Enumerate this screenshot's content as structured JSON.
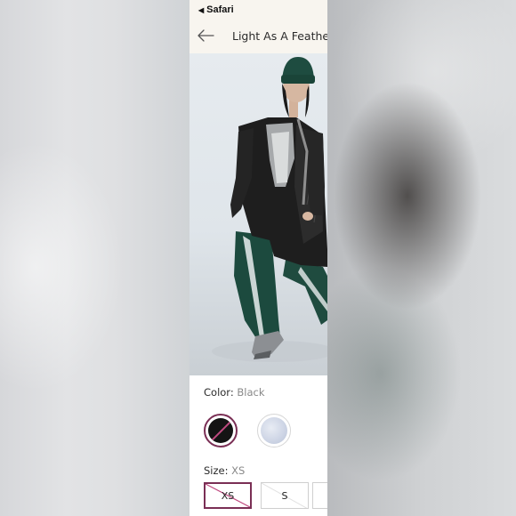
{
  "status_bar": {
    "back_app": "Safari"
  },
  "nav": {
    "title": "Light As A Feather"
  },
  "product": {
    "color": {
      "label": "Color:",
      "selected": "Black"
    },
    "size": {
      "label": "Size:",
      "selected": "XS"
    },
    "sizes": [
      "XS",
      "S",
      ""
    ]
  }
}
